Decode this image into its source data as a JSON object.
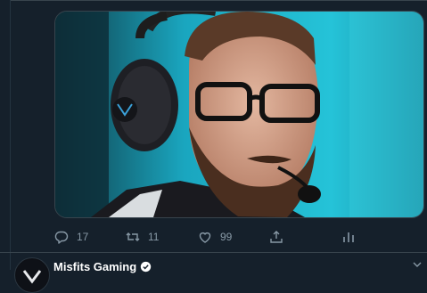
{
  "tweet": {
    "actions": {
      "reply_count": "17",
      "retweet_count": "11",
      "like_count": "99"
    }
  },
  "next_tweet": {
    "author_name": "Misfits Gaming",
    "verified": true
  },
  "colors": {
    "background": "#15202b",
    "divider": "#38444d",
    "icon": "#8899a6",
    "text_primary": "#ffffff",
    "verified_badge": "#ffffff"
  },
  "icons": {
    "reply": "reply-icon",
    "retweet": "retweet-icon",
    "like": "heart-icon",
    "share": "share-icon",
    "analytics": "analytics-icon",
    "verified": "verified-badge-icon",
    "more": "chevron-down-icon"
  }
}
